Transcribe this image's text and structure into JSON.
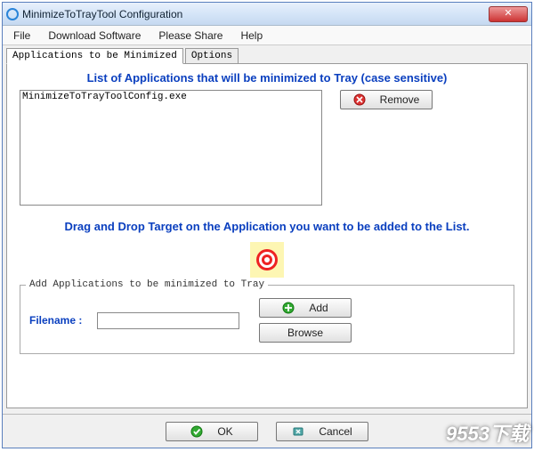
{
  "window": {
    "title": "MinimizeToTrayTool Configuration",
    "close_symbol": "✕"
  },
  "menu": {
    "file": "File",
    "download": "Download Software",
    "share": "Please Share",
    "help": "Help"
  },
  "tabs": {
    "apps": "Applications to be Minimized",
    "options": "Options"
  },
  "main": {
    "list_title": "List of Applications that will be minimized to Tray (case sensitive)",
    "app_list_item": "MinimizeToTrayToolConfig.exe",
    "remove_label": "Remove",
    "drag_title": "Drag and Drop Target on the Application you want to be added to the List.",
    "fieldset_legend": "Add Applications to be minimized to Tray",
    "filename_label": "Filename :",
    "filename_value": "",
    "add_label": "Add",
    "browse_label": "Browse"
  },
  "footer": {
    "ok_label": "OK",
    "cancel_label": "Cancel"
  },
  "watermark": "9553下载"
}
